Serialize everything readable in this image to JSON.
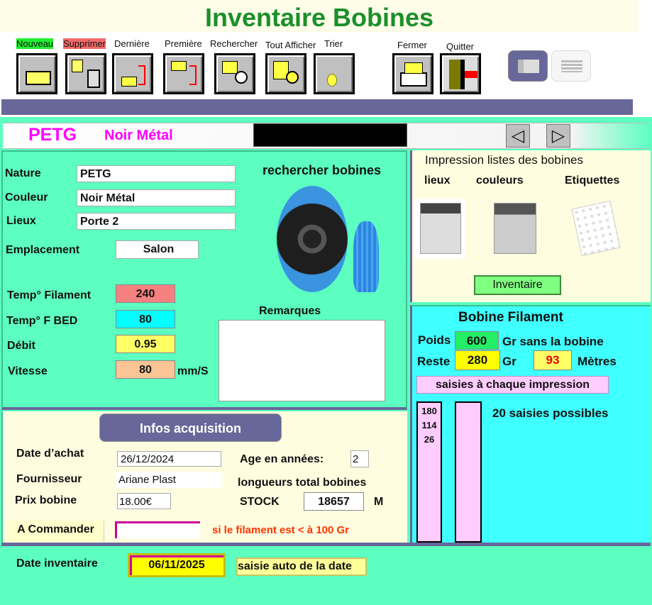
{
  "title": "Inventaire Bobines",
  "toolbar": {
    "nouveau": "Nouveau",
    "supprimer": "Supprimer",
    "derniere": "Dernière",
    "premiere": "Première",
    "rechercher": "Rechercher",
    "tout_afficher": "Tout Afficher",
    "trier": "Trier",
    "fermer": "Fermer",
    "quitter": "Quitter"
  },
  "header": {
    "nature": "PETG",
    "couleur": "Noir Métal"
  },
  "fiche": {
    "nature_label": "Nature",
    "nature": "PETG",
    "couleur_label": "Couleur",
    "couleur": "Noir Métal",
    "lieux_label": "Lieux",
    "lieux": "Porte 2",
    "emplacement_label": "Emplacement",
    "emplacement": "Salon",
    "temp_fil_label": "Temp° Filament",
    "temp_fil": "240",
    "temp_bed_label": "Temp° F BED",
    "temp_bed": "80",
    "debit_label": "Débit",
    "debit": "0.95",
    "vitesse_label": "Vitesse",
    "vitesse": "80",
    "vitesse_unit": "mm/S",
    "rechercher": "rechercher bobines",
    "remarques_label": "Remarques",
    "remarques": ""
  },
  "impression": {
    "title": "Impression listes des bobines",
    "lieux": "lieux",
    "couleurs": "couleurs",
    "etiquettes": "Etiquettes",
    "inventaire": "Inventaire"
  },
  "bobine": {
    "title": "Bobine Filament",
    "poids_label": "Poids",
    "poids": "600",
    "poids_unit": "Gr sans la bobine",
    "reste_label": "Reste",
    "reste": "280",
    "reste_unit": "Gr",
    "metres": "93",
    "metres_unit": "Mètres",
    "saisies_btn": "saisies à chaque impression",
    "saisies": [
      "180",
      "114",
      "26"
    ],
    "possibles": "20 saisies possibles"
  },
  "acquisition": {
    "title": "Infos acquisition",
    "date_label": "Date d’achat",
    "date": "26/12/2024",
    "fournisseur_label": "Fournisseur",
    "fournisseur": "Ariane Plast",
    "prix_label": "Prix bobine",
    "prix": "18.00€",
    "age_label": "Age en années:",
    "age": "2",
    "longueurs": "longueurs total bobines",
    "stock_label": "STOCK",
    "stock": "18657",
    "stock_unit": "M",
    "commander_label": "A Commander",
    "commander": "",
    "commander_note": "si le filament est < à 100 Gr"
  },
  "inventaire": {
    "label": "Date inventaire",
    "date": "06/11/2025",
    "note": "saisie auto de la date"
  }
}
